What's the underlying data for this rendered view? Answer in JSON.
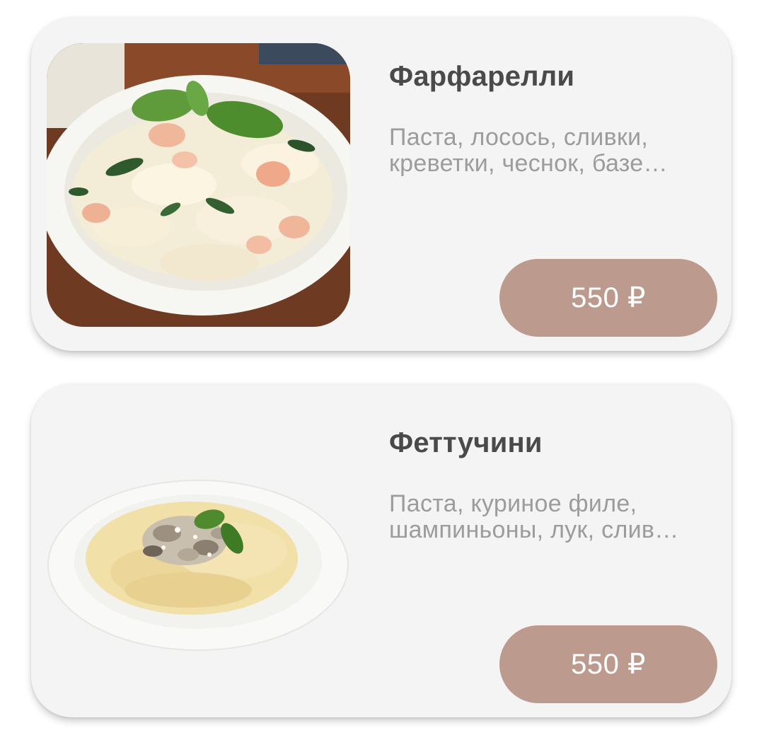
{
  "menu": {
    "items": [
      {
        "name": "Фарфарелли",
        "description": "Паста, лосось, сливки, креветки, чеснок, базе…",
        "price": "550 ₽",
        "image": "farfalle-salmon-photo"
      },
      {
        "name": "Феттучини",
        "description": "Паста, куриное филе, шампиньоны, лук, слив…",
        "price": "550 ₽",
        "image": "fettuccine-mushroom-photo"
      }
    ]
  },
  "colors": {
    "card_background": "#f4f4f4",
    "title": "#4a4a4a",
    "description": "#9c9c9c",
    "price_button": "#bd9a8e",
    "price_text": "#ffffff"
  }
}
